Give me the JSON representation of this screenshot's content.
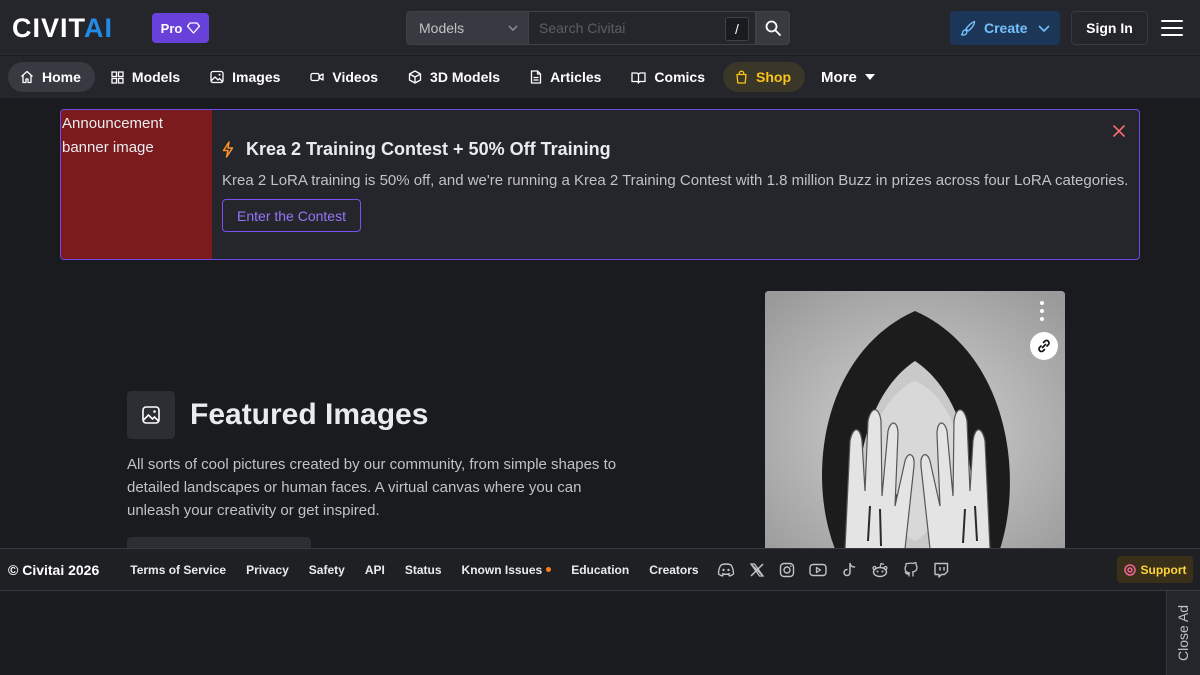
{
  "header": {
    "logo_prefix": "CIVIT",
    "logo_suffix": "AI",
    "pro_label": "Pro",
    "search": {
      "selected": "Models",
      "placeholder": "Search Civitai",
      "shortcut": "/"
    },
    "create_label": "Create",
    "signin_label": "Sign In"
  },
  "nav": {
    "items": [
      {
        "label": "Home",
        "icon": "home-icon"
      },
      {
        "label": "Models",
        "icon": "grid-icon"
      },
      {
        "label": "Images",
        "icon": "photo-icon"
      },
      {
        "label": "Videos",
        "icon": "video-icon"
      },
      {
        "label": "3D Models",
        "icon": "cube-icon"
      },
      {
        "label": "Articles",
        "icon": "article-icon"
      },
      {
        "label": "Comics",
        "icon": "book-icon"
      },
      {
        "label": "Shop",
        "icon": "shopping-bag-icon"
      },
      {
        "label": "More",
        "icon": "caret-down-icon"
      }
    ]
  },
  "announcement": {
    "image_alt": "Announcement banner image",
    "title": "Krea 2 Training Contest + 50% Off Training",
    "text": "Krea 2 LoRA training is 50% off, and we're running a Krea 2 Training Contest with 1.8 million Buzz in prizes across four LoRA categories.",
    "button": "Enter the Contest"
  },
  "featured": {
    "title": "Featured Images",
    "description": "All sorts of cool pictures created by our community, from simple shapes to detailed landscapes or human faces. A virtual canvas where you can unleash your creativity or get inspired."
  },
  "footer": {
    "copyright": "© Civitai 2026",
    "links": [
      "Terms of Service",
      "Privacy",
      "Safety",
      "API",
      "Status",
      "Known Issues",
      "Education",
      "Creators"
    ],
    "socials": [
      "discord-icon",
      "x-icon",
      "instagram-icon",
      "youtube-icon",
      "tiktok-icon",
      "reddit-icon",
      "github-icon",
      "twitch-icon"
    ],
    "support_label": "Support"
  },
  "close_ad": "Close Ad",
  "colors": {
    "accent": "#228be6",
    "pro": "#6741d9",
    "announce_border": "#7048e8",
    "shop": "#fcc419"
  }
}
